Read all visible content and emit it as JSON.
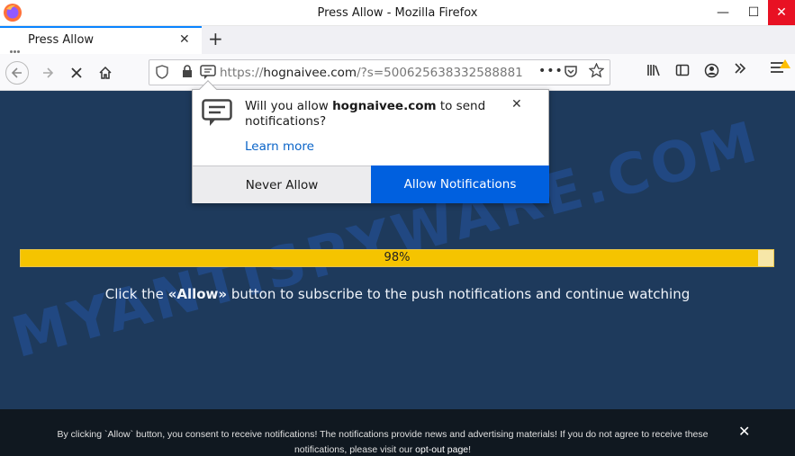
{
  "window": {
    "title": "Press Allow - Mozilla Firefox",
    "minimize_label": "—",
    "maximize_label": "☐",
    "close_label": "✕"
  },
  "tab": {
    "title": "Press Allow",
    "close_label": "✕",
    "new_tab_label": "+"
  },
  "urlbar": {
    "scheme": "https://",
    "host": "hognaivee.com",
    "path": "/?s=500625638332588881",
    "more_label": "•••"
  },
  "popup": {
    "message_pre": "Will you allow ",
    "message_site": "hognaivee.com",
    "message_post": " to send notifications?",
    "learn_more": "Learn more",
    "never_allow": "Never Allow",
    "allow": "Allow Notifications",
    "close_label": "✕"
  },
  "page": {
    "watermark": "MYANTISPYWARE.COM",
    "progress_percent": 98,
    "progress_label": "98%",
    "instruction_pre": "Click the ",
    "instruction_bold": "«Allow»",
    "instruction_post": " button to subscribe to the push notifications and continue watching"
  },
  "banner": {
    "text": "By clicking `Allow` button, you consent to receive notifications! The notifications provide news and advertising materials! If you do not agree to receive these notifications, please visit our ",
    "link": "opt-out page",
    "suffix": "!",
    "close_label": "✕"
  },
  "colors": {
    "page_bg": "#1e3a5c",
    "progress_fill": "#f5c400",
    "allow_button": "#0060df",
    "close_button": "#e81123"
  }
}
